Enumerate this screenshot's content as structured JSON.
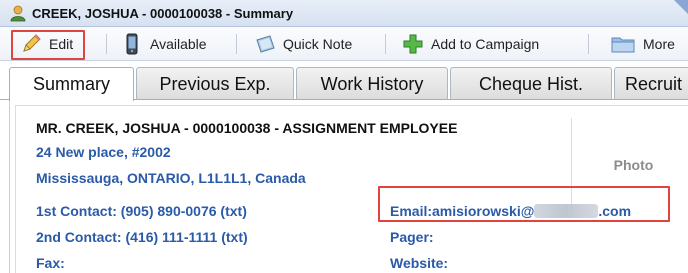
{
  "window": {
    "title": "CREEK, JOSHUA - 0000100038 - Summary",
    "icon": "user-icon"
  },
  "toolbar": {
    "edit": "Edit",
    "available": "Available",
    "quick_note": "Quick Note",
    "add_to_campaign": "Add to Campaign",
    "more": "More"
  },
  "tabs": [
    {
      "label": "Summary",
      "active": true
    },
    {
      "label": "Previous Exp."
    },
    {
      "label": "Work History"
    },
    {
      "label": "Cheque Hist."
    },
    {
      "label": "Recruit"
    }
  ],
  "employee": {
    "header": "MR. CREEK, JOSHUA - 0000100038 - ASSIGNMENT EMPLOYEE",
    "address_line1": "24 New place, #2002",
    "address_line2": "Mississauga, ONTARIO, L1L1L1, Canada",
    "photo_label": "Photo",
    "first_contact_label": "1st Contact:",
    "first_contact_value": "(905) 890-0076 (txt)",
    "second_contact_label": "2nd Contact:",
    "second_contact_value": "(416) 111-1111 (txt)",
    "fax_label": "Fax:",
    "email_label": "Email:",
    "email_prefix": "amisiorowski@",
    "email_suffix": ".com",
    "pager_label": "Pager:",
    "website_label": "Website:"
  },
  "colors": {
    "highlight_box": "#e0443f",
    "link_blue": "#2a5aa8"
  }
}
